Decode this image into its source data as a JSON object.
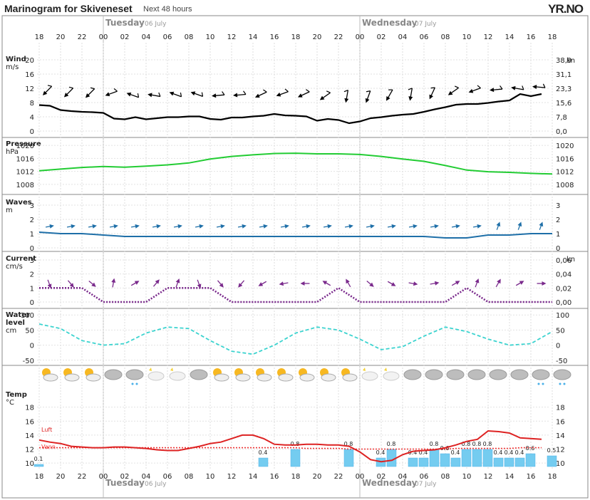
{
  "header": {
    "title": "Marinogram for Skiveneset",
    "subtitle": "Next 48 hours",
    "logo": "YR.NO"
  },
  "days": [
    {
      "name": "Tuesday",
      "date": "06 July"
    },
    {
      "name": "Wednesday",
      "date": "07 July"
    }
  ],
  "hour_labels": [
    "18",
    "20",
    "22",
    "00",
    "02",
    "04",
    "06",
    "08",
    "10",
    "12",
    "14",
    "16",
    "18",
    "20",
    "22",
    "00",
    "02",
    "04",
    "06",
    "08",
    "10",
    "12",
    "14",
    "16",
    "18"
  ],
  "panels": {
    "wind": {
      "label1": "Wind",
      "label2": "m/s",
      "ticks": [
        "0",
        "4",
        "8",
        "12",
        "16",
        "20"
      ],
      "right_ticks": [
        "0,0",
        "7,8",
        "15,6",
        "23,3",
        "31,1",
        "38,9"
      ],
      "right_unit": "kn"
    },
    "pressure": {
      "label1": "Pressure",
      "label2": "hPa",
      "ticks": [
        "1008",
        "1012",
        "1016",
        "1020"
      ]
    },
    "waves": {
      "label1": "Waves",
      "label2": "m",
      "ticks": [
        "0",
        "1",
        "2",
        "3"
      ]
    },
    "current": {
      "label1": "Current",
      "label2": "cm/s",
      "ticks": [
        "0",
        "1",
        "2",
        "3"
      ],
      "right_ticks": [
        "0,00",
        "0,02",
        "0,04",
        "0,06"
      ],
      "right_unit": "kn"
    },
    "water": {
      "label1": "Water",
      "label2": "level",
      "label3": "cm",
      "ticks": [
        "-50",
        "0",
        "50",
        "100"
      ]
    },
    "temp": {
      "label1": "Temp",
      "label2": "°C",
      "ticks": [
        "10",
        "12",
        "14",
        "16",
        "18"
      ],
      "legend_air": "Luft",
      "legend_water": "Vann"
    }
  },
  "colors": {
    "wind": "#000000",
    "pressure": "#22cc33",
    "waves": "#1e6fa8",
    "current": "#7a2a8c",
    "water": "#3bd3cf",
    "air_temp": "#dd2222",
    "water_temp": "#ee3333",
    "precip": "#74ccf0"
  },
  "chart_data": [
    {
      "type": "line",
      "title": "Wind",
      "ylabel": "m/s",
      "xlabel": "",
      "ylim": [
        0,
        20
      ],
      "x": [
        "18",
        "19",
        "20",
        "21",
        "22",
        "23",
        "00",
        "01",
        "02",
        "03",
        "04",
        "05",
        "06",
        "07",
        "08",
        "09",
        "10",
        "11",
        "12",
        "13",
        "14",
        "15",
        "16",
        "17",
        "18",
        "19",
        "20",
        "21",
        "22",
        "23",
        "00",
        "01",
        "02",
        "03",
        "04",
        "05",
        "06",
        "07",
        "08",
        "09",
        "10",
        "11",
        "12",
        "13",
        "14",
        "15",
        "16",
        "17"
      ],
      "series": [
        {
          "values": [
            7.3,
            7.1,
            5.9,
            5.6,
            5.4,
            5.3,
            5.1,
            3.5,
            3.3,
            3.9,
            3.3,
            3.6,
            3.9,
            3.9,
            4.1,
            4.1,
            3.4,
            3.2,
            3.8,
            3.8,
            4.1,
            4.3,
            4.8,
            4.4,
            4.3,
            4.1,
            2.9,
            3.4,
            3.1,
            2.2,
            2.7,
            3.6,
            3.9,
            4.3,
            4.6,
            4.8,
            5.4,
            6.1,
            6.7,
            7.4,
            7.6,
            7.6,
            7.9,
            8.3,
            8.6,
            10.4,
            9.8,
            10.4
          ]
        }
      ],
      "arrows_direction_deg": [
        225,
        215,
        225,
        215,
        225,
        230,
        250,
        280,
        290,
        285,
        280,
        285,
        290,
        285,
        290,
        255,
        265,
        255,
        265,
        250,
        245,
        240,
        250,
        260,
        245,
        250,
        235,
        225,
        190,
        190,
        200,
        205,
        210,
        200,
        190,
        195,
        205,
        210,
        235,
        240,
        250,
        260,
        265,
        275,
        280,
        270,
        275,
        275
      ]
    },
    {
      "type": "line",
      "title": "Pressure",
      "ylabel": "hPa",
      "xlabel": "",
      "ylim": [
        1006,
        1022
      ],
      "x": [
        "18",
        "20",
        "22",
        "00",
        "02",
        "04",
        "06",
        "08",
        "10",
        "12",
        "14",
        "16",
        "18",
        "20",
        "22",
        "00",
        "02",
        "04",
        "06",
        "08",
        "10",
        "12",
        "14",
        "16",
        "18"
      ],
      "series": [
        {
          "values": [
            1012.2,
            1012.7,
            1013.2,
            1013.5,
            1013.3,
            1013.6,
            1014.0,
            1014.6,
            1015.8,
            1016.6,
            1017.1,
            1017.5,
            1017.6,
            1017.4,
            1017.4,
            1017.2,
            1016.6,
            1015.8,
            1015.1,
            1013.8,
            1012.4,
            1011.9,
            1011.7,
            1011.4,
            1011.2
          ]
        }
      ]
    },
    {
      "type": "line",
      "title": "Waves",
      "ylabel": "m",
      "xlabel": "",
      "ylim": [
        0,
        3
      ],
      "x": [
        "18",
        "20",
        "22",
        "00",
        "02",
        "04",
        "06",
        "08",
        "10",
        "12",
        "14",
        "16",
        "18",
        "20",
        "22",
        "00",
        "02",
        "04",
        "06",
        "08",
        "10",
        "12",
        "14",
        "16",
        "18"
      ],
      "series": [
        {
          "values": [
            1.1,
            1.0,
            1.0,
            0.9,
            0.8,
            0.8,
            0.8,
            0.8,
            0.8,
            0.8,
            0.8,
            0.8,
            0.8,
            0.8,
            0.8,
            0.8,
            0.8,
            0.8,
            0.8,
            0.7,
            0.7,
            0.9,
            0.9,
            1.0,
            1.0
          ]
        }
      ]
    },
    {
      "type": "line",
      "title": "Current",
      "ylabel": "cm/s",
      "xlabel": "",
      "ylim": [
        0,
        3
      ],
      "x": [
        "18",
        "20",
        "22",
        "00",
        "02",
        "04",
        "06",
        "08",
        "10",
        "12",
        "14",
        "16",
        "18",
        "20",
        "22",
        "00",
        "02",
        "04",
        "06",
        "08",
        "10",
        "12",
        "14",
        "16",
        "18"
      ],
      "series": [
        {
          "values": [
            1,
            1,
            1,
            0,
            0,
            0,
            1,
            1,
            1,
            0,
            0,
            0,
            0,
            0,
            1,
            0,
            0,
            0,
            0,
            0,
            1,
            0,
            0,
            0,
            0
          ]
        }
      ]
    },
    {
      "type": "line",
      "title": "Water level",
      "ylabel": "cm",
      "xlabel": "",
      "ylim": [
        -60,
        110
      ],
      "x": [
        "18",
        "20",
        "22",
        "00",
        "02",
        "04",
        "06",
        "08",
        "10",
        "12",
        "14",
        "16",
        "18",
        "20",
        "22",
        "00",
        "02",
        "04",
        "06",
        "08",
        "10",
        "12",
        "14",
        "16",
        "18"
      ],
      "series": [
        {
          "values": [
            70,
            55,
            15,
            0,
            5,
            40,
            60,
            55,
            15,
            -20,
            -30,
            0,
            40,
            60,
            50,
            20,
            -15,
            -5,
            30,
            60,
            45,
            20,
            0,
            5,
            45
          ]
        }
      ]
    },
    {
      "type": "line",
      "title": "Temp",
      "ylabel": "°C",
      "xlabel": "",
      "ylim": [
        9,
        20
      ],
      "x": [
        "18",
        "19",
        "20",
        "21",
        "22",
        "23",
        "00",
        "01",
        "02",
        "03",
        "04",
        "05",
        "06",
        "07",
        "08",
        "09",
        "10",
        "11",
        "12",
        "13",
        "14",
        "15",
        "16",
        "17",
        "18",
        "19",
        "20",
        "21",
        "22",
        "23",
        "00",
        "01",
        "02",
        "03",
        "04",
        "05",
        "06",
        "07",
        "08",
        "09",
        "10",
        "11",
        "12",
        "13",
        "14",
        "15",
        "16",
        "17"
      ],
      "series": [
        {
          "name": "Luft",
          "values": [
            13.3,
            13.0,
            12.8,
            12.4,
            12.3,
            12.2,
            12.2,
            12.3,
            12.3,
            12.2,
            12.1,
            11.9,
            11.8,
            11.8,
            12.1,
            12.4,
            12.8,
            13.0,
            13.5,
            14.0,
            14.0,
            13.5,
            12.7,
            12.6,
            12.6,
            12.7,
            12.7,
            12.6,
            12.6,
            12.4,
            11.6,
            10.5,
            10.2,
            10.4,
            11.2,
            11.7,
            11.8,
            11.9,
            12.2,
            12.6,
            13.1,
            13.4,
            14.6,
            14.5,
            14.3,
            13.6,
            13.5,
            13.4
          ]
        },
        {
          "name": "Vann",
          "values": [
            12.2,
            12.2,
            12.2,
            12.2,
            12.2,
            12.2,
            12.2,
            12.2,
            12.2,
            12.2,
            12.2,
            12.2,
            12.2,
            12.2,
            12.2,
            12.2,
            12.2,
            12.2,
            12.2,
            12.2,
            12.2,
            12.2,
            12.2,
            12.2,
            12.2,
            12.1,
            12.1,
            12.1,
            12.1,
            12.0,
            12.0,
            12.0,
            12.0,
            12.0,
            12.0,
            12.0,
            12.0,
            12.0,
            12.0,
            12.1,
            12.1,
            12.1,
            12.1,
            12.1,
            12.1,
            12.2,
            12.2,
            12.2
          ]
        }
      ],
      "precip_mm": [
        0.1,
        0,
        0,
        0,
        0,
        0,
        0,
        0,
        0,
        0,
        0,
        0,
        0,
        0,
        0,
        0,
        0,
        0,
        0,
        0,
        0,
        0.4,
        0,
        0,
        0.8,
        0,
        0,
        0,
        0,
        0.8,
        0,
        0,
        0.4,
        0.8,
        0,
        0.4,
        0.4,
        0.8,
        0.6,
        0.4,
        0.8,
        0.8,
        0.8,
        0.4,
        0.4,
        0.4,
        0.6,
        0,
        0.5
      ]
    }
  ],
  "weather_icons": [
    "sun",
    "sun",
    "sun",
    "cloud",
    "rain",
    "light",
    "light",
    "cloud",
    "sun",
    "sun",
    "sun",
    "sun",
    "sun",
    "sun",
    "sun",
    "light",
    "light",
    "cloud",
    "cloud",
    "cloud",
    "cloud",
    "cloud",
    "cloud",
    "rain",
    "rain"
  ]
}
